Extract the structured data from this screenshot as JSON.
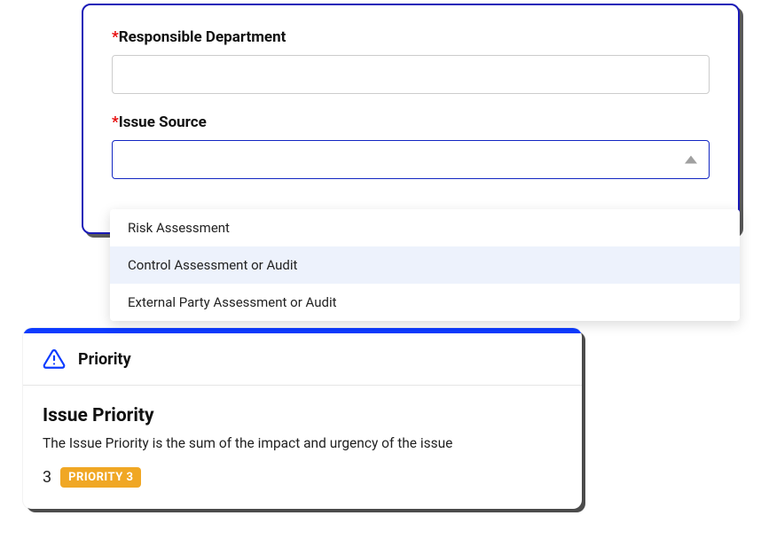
{
  "form": {
    "responsible_department": {
      "label": "Responsible Department",
      "value": ""
    },
    "issue_source": {
      "label": "Issue Source",
      "value": "",
      "options": [
        "Risk Assessment",
        "Control Assessment or Audit",
        "External Party Assessment or Audit"
      ],
      "highlighted_index": 1
    }
  },
  "priority": {
    "header": "Priority",
    "title": "Issue Priority",
    "description": "The Issue Priority is the sum of the impact and urgency of the issue",
    "score": "3",
    "badge": "PRIORITY 3"
  },
  "icons": {
    "warning": "warning-triangle"
  }
}
